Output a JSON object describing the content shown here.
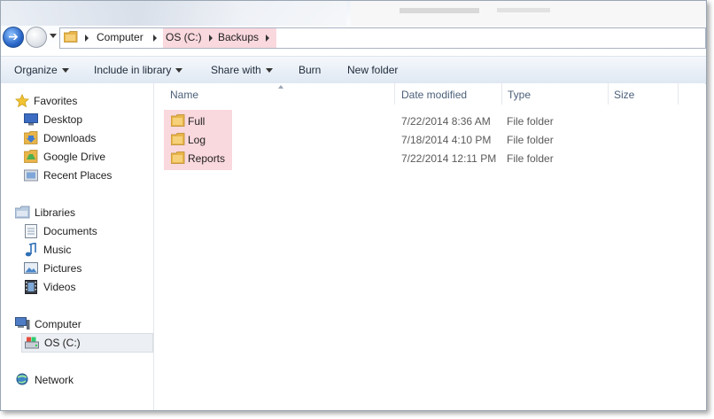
{
  "address_bar": {
    "crumbs": [
      "Computer",
      "OS (C:)",
      "Backups"
    ]
  },
  "toolbar": {
    "organize": "Organize",
    "include_in_library": "Include in library",
    "share_with": "Share with",
    "burn": "Burn",
    "new_folder": "New folder"
  },
  "navigation": {
    "favorites": {
      "label": "Favorites",
      "items": [
        "Desktop",
        "Downloads",
        "Google Drive",
        "Recent Places"
      ]
    },
    "libraries": {
      "label": "Libraries",
      "items": [
        "Documents",
        "Music",
        "Pictures",
        "Videos"
      ]
    },
    "computer": {
      "label": "Computer",
      "items": [
        "OS (C:)"
      ],
      "selected": "OS (C:)"
    },
    "network": {
      "label": "Network"
    }
  },
  "columns": [
    "Name",
    "Date modified",
    "Type",
    "Size"
  ],
  "files": [
    {
      "name": "Full",
      "date": "7/22/2014 8:36 AM",
      "type": "File folder"
    },
    {
      "name": "Log",
      "date": "7/18/2014 4:10 PM",
      "type": "File folder"
    },
    {
      "name": "Reports",
      "date": "7/22/2014 12:11 PM",
      "type": "File folder"
    }
  ],
  "colors": {
    "highlight": "#f9d8de",
    "folder": "#e8b54a",
    "header_text": "#4c607a"
  }
}
